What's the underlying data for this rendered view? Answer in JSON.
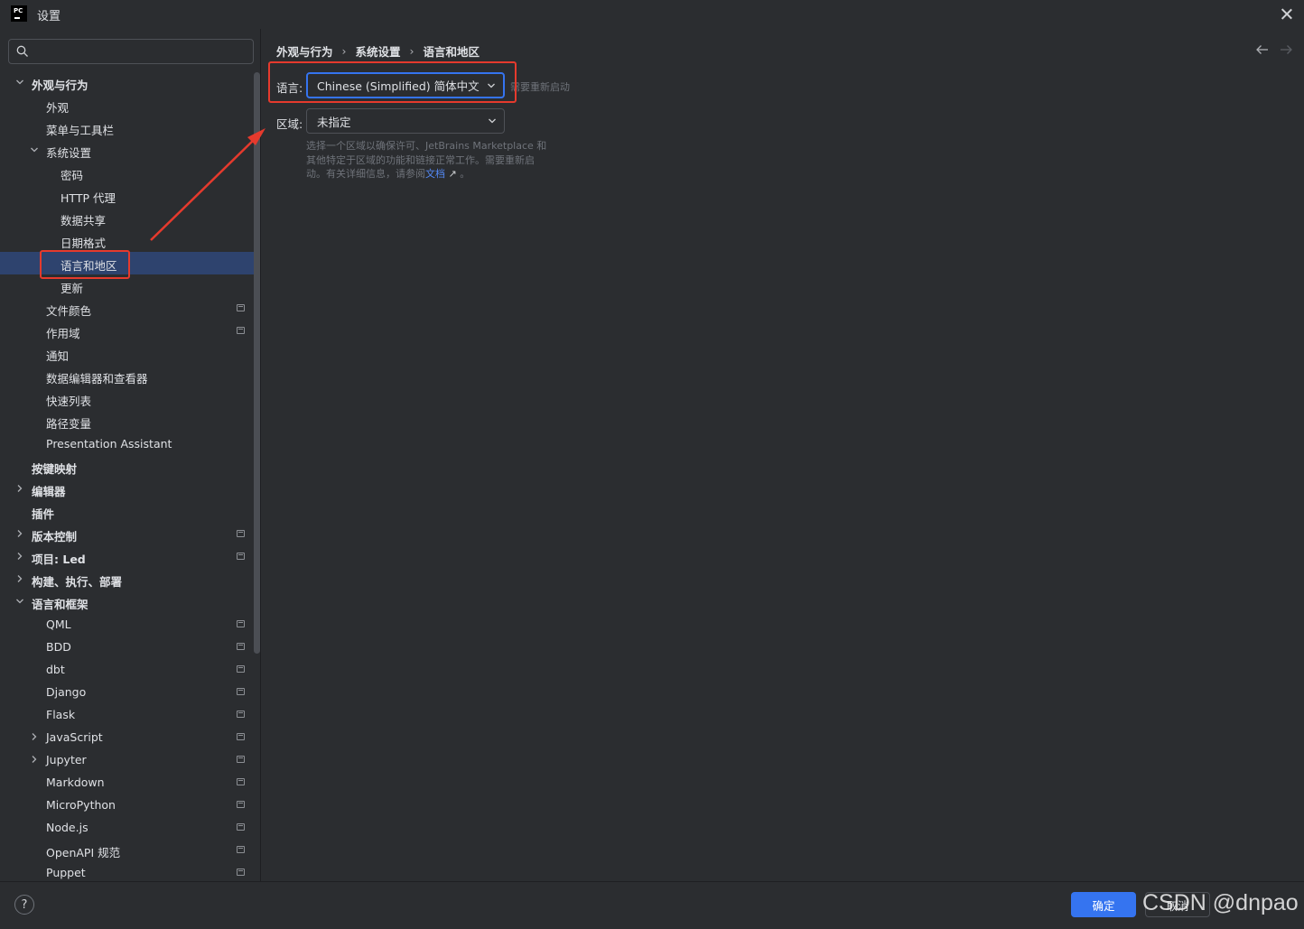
{
  "window": {
    "title": "设置",
    "app_icon_text": "PC"
  },
  "search": {
    "value": "",
    "placeholder": ""
  },
  "tree": [
    {
      "label": "外观与行为",
      "level": 0,
      "chevron": "down",
      "bold": true
    },
    {
      "label": "外观",
      "level": 1
    },
    {
      "label": "菜单与工具栏",
      "level": 1
    },
    {
      "label": "系统设置",
      "level": 1,
      "chevron": "down"
    },
    {
      "label": "密码",
      "level": 2
    },
    {
      "label": "HTTP 代理",
      "level": 2
    },
    {
      "label": "数据共享",
      "level": 2
    },
    {
      "label": "日期格式",
      "level": 2
    },
    {
      "label": "语言和地区",
      "level": 2,
      "selected": true
    },
    {
      "label": "更新",
      "level": 2
    },
    {
      "label": "文件颜色",
      "level": 1,
      "project": true
    },
    {
      "label": "作用域",
      "level": 1,
      "project": true
    },
    {
      "label": "通知",
      "level": 1
    },
    {
      "label": "数据编辑器和查看器",
      "level": 1
    },
    {
      "label": "快速列表",
      "level": 1
    },
    {
      "label": "路径变量",
      "level": 1
    },
    {
      "label": "Presentation Assistant",
      "level": 1
    },
    {
      "label": "按键映射",
      "level": 0,
      "bold": true
    },
    {
      "label": "编辑器",
      "level": 0,
      "chevron": "right",
      "bold": true
    },
    {
      "label": "插件",
      "level": 0,
      "bold": true
    },
    {
      "label": "版本控制",
      "level": 0,
      "chevron": "right",
      "bold": true,
      "project": true
    },
    {
      "label": "项目: Led",
      "level": 0,
      "chevron": "right",
      "bold": true,
      "project": true
    },
    {
      "label": "构建、执行、部署",
      "level": 0,
      "chevron": "right",
      "bold": true
    },
    {
      "label": "语言和框架",
      "level": 0,
      "chevron": "down",
      "bold": true
    },
    {
      "label": "QML",
      "level": 1,
      "project": true
    },
    {
      "label": "BDD",
      "level": 1,
      "project": true
    },
    {
      "label": "dbt",
      "level": 1,
      "project": true
    },
    {
      "label": "Django",
      "level": 1,
      "project": true
    },
    {
      "label": "Flask",
      "level": 1,
      "project": true
    },
    {
      "label": "JavaScript",
      "level": 1,
      "chevron": "right",
      "project": true
    },
    {
      "label": "Jupyter",
      "level": 1,
      "chevron": "right",
      "project": true
    },
    {
      "label": "Markdown",
      "level": 1,
      "project": true
    },
    {
      "label": "MicroPython",
      "level": 1,
      "project": true
    },
    {
      "label": "Node.js",
      "level": 1,
      "project": true
    },
    {
      "label": "OpenAPI 规范",
      "level": 1,
      "project": true
    },
    {
      "label": "Puppet",
      "level": 1,
      "project": true
    }
  ],
  "breadcrumb": [
    "外观与行为",
    "系统设置",
    "语言和地区"
  ],
  "form": {
    "language_label": "语言:",
    "language_value": "Chinese (Simplified) 简体中文",
    "restart_hint": "需要重新启动",
    "region_label": "区域:",
    "region_value": "未指定",
    "help_text": "选择一个区域以确保许可、JetBrains Marketplace 和其他特定于区域的功能和链接正常工作。需要重新启动。有关详细信息，请参阅",
    "help_link": "文档",
    "help_link_arrow": "↗",
    "help_suffix": "。"
  },
  "footer": {
    "help_label": "?",
    "ok_label": "确定",
    "cancel_label": "取消"
  },
  "watermark": "CSDN @dnpao",
  "colors": {
    "accent": "#3574f0",
    "selection": "#2e436e",
    "annotation": "#e53a2d",
    "link": "#548af7"
  }
}
